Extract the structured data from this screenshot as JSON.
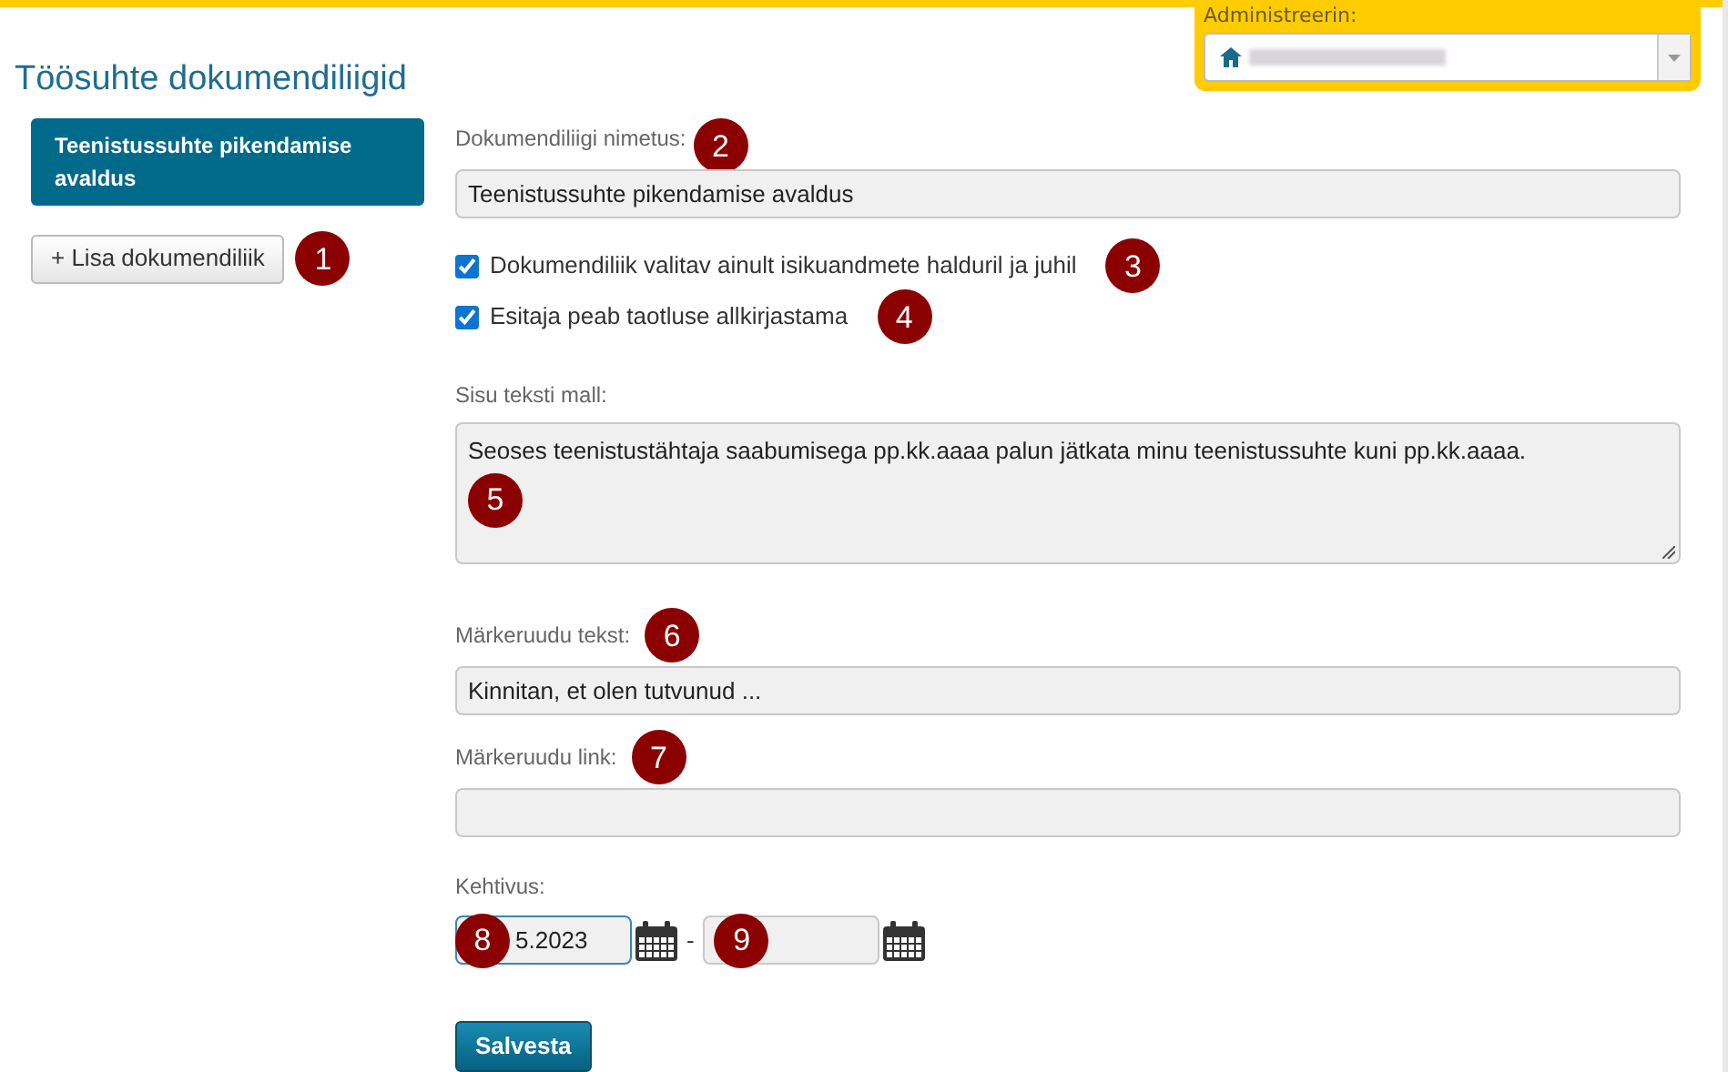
{
  "page_title": "Töösuhte dokumendiliigid",
  "admin": {
    "label": "Administreerin:"
  },
  "sidebar": {
    "items": [
      {
        "label": "Teenistussuhte pikendamise avaldus",
        "selected": true
      }
    ],
    "add_button": "+ Lisa dokumendiliik"
  },
  "form": {
    "name_label": "Dokumendiliigi nimetus:",
    "name_value": "Teenistussuhte pikendamise avaldus",
    "checkboxes": [
      {
        "label": "Dokumendiliik valitav ainult isikuandmete halduril ja juhil",
        "checked": true
      },
      {
        "label": "Esitaja peab taotluse allkirjastama",
        "checked": true
      }
    ],
    "template_label": "Sisu teksti mall:",
    "template_value": "Seoses teenistustähtaja saabumisega pp.kk.aaaa palun jätkata minu teenistussuhte kuni pp.kk.aaaa.",
    "checkbox_text_label": "Märkeruudu tekst:",
    "checkbox_text_value": "Kinnitan, et olen tutvunud ...",
    "checkbox_link_label": "Märkeruudu link:",
    "validity_label": "Kehtivus:",
    "valid_from": "5.2023",
    "separator": "-",
    "save_button": "Salvesta"
  },
  "callouts": [
    "1",
    "2",
    "3",
    "4",
    "5",
    "6",
    "7",
    "8",
    "9"
  ]
}
